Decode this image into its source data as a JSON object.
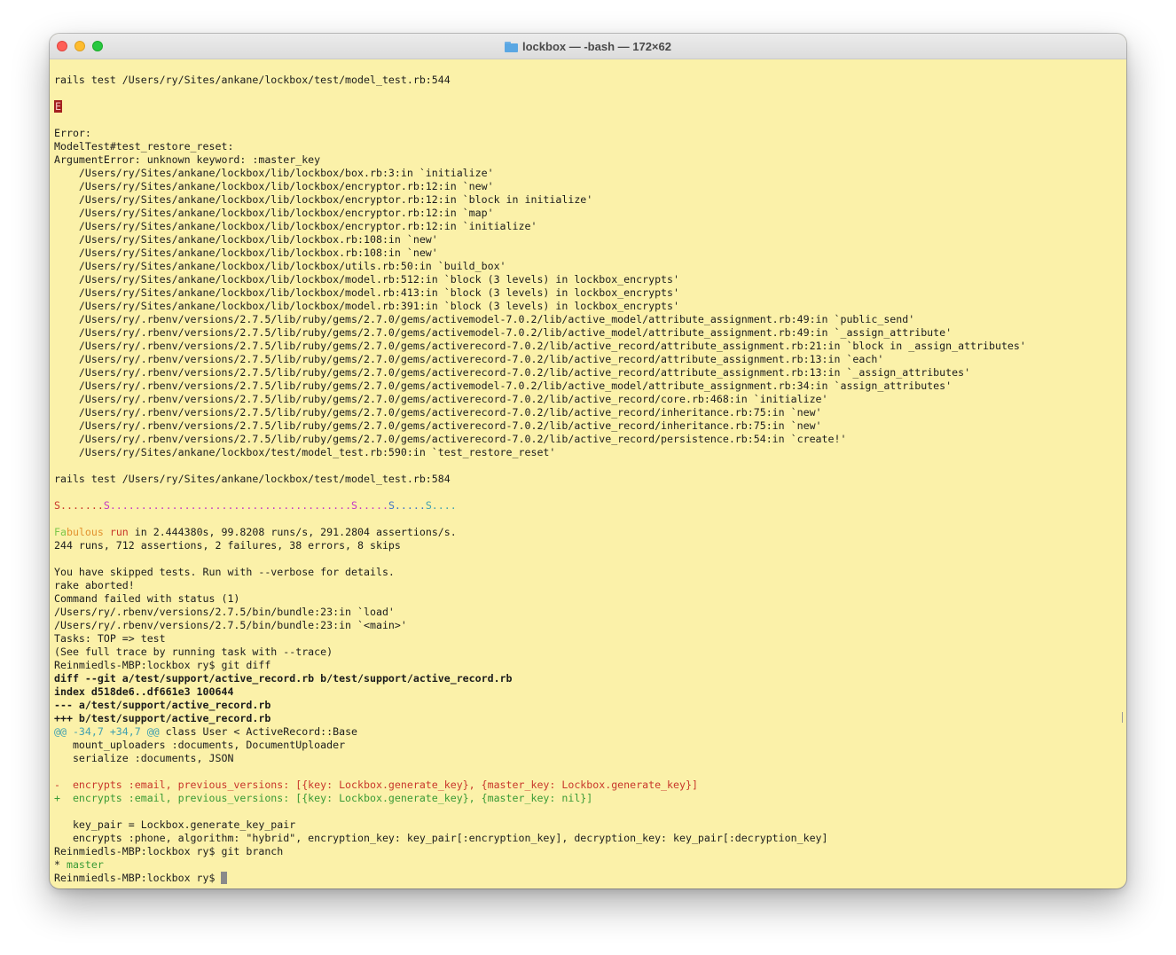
{
  "window": {
    "title": "lockbox — -bash — 172×62"
  },
  "colors": {
    "background": "#fbf1a9",
    "text": "#1c1c1c",
    "red": "#c8372b",
    "green": "#3a9a35",
    "magenta": "#c436c4",
    "blue": "#3f73c8",
    "cyan": "#40a0b0",
    "lightgreen": "#7dc74b",
    "orange": "#e2912e"
  },
  "terminal": {
    "lines": [
      [
        {
          "t": "rails test /Users/ry/Sites/ankane/lockbox/test/model_test.rb:544"
        }
      ],
      [],
      [
        {
          "t": "E",
          "c": "cursor-E"
        }
      ],
      [],
      [
        {
          "t": "Error:"
        }
      ],
      [
        {
          "t": "ModelTest#test_restore_reset:"
        }
      ],
      [
        {
          "t": "ArgumentError: unknown keyword: :master_key"
        }
      ],
      [
        {
          "t": "    /Users/ry/Sites/ankane/lockbox/lib/lockbox/box.rb:3:in `initialize'"
        }
      ],
      [
        {
          "t": "    /Users/ry/Sites/ankane/lockbox/lib/lockbox/encryptor.rb:12:in `new'"
        }
      ],
      [
        {
          "t": "    /Users/ry/Sites/ankane/lockbox/lib/lockbox/encryptor.rb:12:in `block in initialize'"
        }
      ],
      [
        {
          "t": "    /Users/ry/Sites/ankane/lockbox/lib/lockbox/encryptor.rb:12:in `map'"
        }
      ],
      [
        {
          "t": "    /Users/ry/Sites/ankane/lockbox/lib/lockbox/encryptor.rb:12:in `initialize'"
        }
      ],
      [
        {
          "t": "    /Users/ry/Sites/ankane/lockbox/lib/lockbox.rb:108:in `new'"
        }
      ],
      [
        {
          "t": "    /Users/ry/Sites/ankane/lockbox/lib/lockbox.rb:108:in `new'"
        }
      ],
      [
        {
          "t": "    /Users/ry/Sites/ankane/lockbox/lib/lockbox/utils.rb:50:in `build_box'"
        }
      ],
      [
        {
          "t": "    /Users/ry/Sites/ankane/lockbox/lib/lockbox/model.rb:512:in `block (3 levels) in lockbox_encrypts'"
        }
      ],
      [
        {
          "t": "    /Users/ry/Sites/ankane/lockbox/lib/lockbox/model.rb:413:in `block (3 levels) in lockbox_encrypts'"
        }
      ],
      [
        {
          "t": "    /Users/ry/Sites/ankane/lockbox/lib/lockbox/model.rb:391:in `block (3 levels) in lockbox_encrypts'"
        }
      ],
      [
        {
          "t": "    /Users/ry/.rbenv/versions/2.7.5/lib/ruby/gems/2.7.0/gems/activemodel-7.0.2/lib/active_model/attribute_assignment.rb:49:in `public_send'"
        }
      ],
      [
        {
          "t": "    /Users/ry/.rbenv/versions/2.7.5/lib/ruby/gems/2.7.0/gems/activemodel-7.0.2/lib/active_model/attribute_assignment.rb:49:in `_assign_attribute'"
        }
      ],
      [
        {
          "t": "    /Users/ry/.rbenv/versions/2.7.5/lib/ruby/gems/2.7.0/gems/activerecord-7.0.2/lib/active_record/attribute_assignment.rb:21:in `block in _assign_attributes'"
        }
      ],
      [
        {
          "t": "    /Users/ry/.rbenv/versions/2.7.5/lib/ruby/gems/2.7.0/gems/activerecord-7.0.2/lib/active_record/attribute_assignment.rb:13:in `each'"
        }
      ],
      [
        {
          "t": "    /Users/ry/.rbenv/versions/2.7.5/lib/ruby/gems/2.7.0/gems/activerecord-7.0.2/lib/active_record/attribute_assignment.rb:13:in `_assign_attributes'"
        }
      ],
      [
        {
          "t": "    /Users/ry/.rbenv/versions/2.7.5/lib/ruby/gems/2.7.0/gems/activemodel-7.0.2/lib/active_model/attribute_assignment.rb:34:in `assign_attributes'"
        }
      ],
      [
        {
          "t": "    /Users/ry/.rbenv/versions/2.7.5/lib/ruby/gems/2.7.0/gems/activerecord-7.0.2/lib/active_record/core.rb:468:in `initialize'"
        }
      ],
      [
        {
          "t": "    /Users/ry/.rbenv/versions/2.7.5/lib/ruby/gems/2.7.0/gems/activerecord-7.0.2/lib/active_record/inheritance.rb:75:in `new'"
        }
      ],
      [
        {
          "t": "    /Users/ry/.rbenv/versions/2.7.5/lib/ruby/gems/2.7.0/gems/activerecord-7.0.2/lib/active_record/inheritance.rb:75:in `new'"
        }
      ],
      [
        {
          "t": "    /Users/ry/.rbenv/versions/2.7.5/lib/ruby/gems/2.7.0/gems/activerecord-7.0.2/lib/active_record/persistence.rb:54:in `create!'"
        }
      ],
      [
        {
          "t": "    /Users/ry/Sites/ankane/lockbox/test/model_test.rb:590:in `test_restore_reset'"
        }
      ],
      [],
      [
        {
          "t": "rails test /Users/ry/Sites/ankane/lockbox/test/model_test.rb:584"
        }
      ],
      [],
      [
        {
          "t": "S.......",
          "k": "red"
        },
        {
          "t": "S.......................................",
          "k": "magenta"
        },
        {
          "t": "S.....",
          "k": "magenta"
        },
        {
          "t": "S.....",
          "k": "blue"
        },
        {
          "t": "S....",
          "k": "cyan"
        }
      ],
      [],
      [
        {
          "t": "Fa",
          "k": "lightgreen"
        },
        {
          "t": "bulous ",
          "k": "orange"
        },
        {
          "t": "run",
          "k": "red"
        },
        {
          "t": " in 2.444380s, 99.8208 runs/s, 291.2804 assertions/s."
        }
      ],
      [
        {
          "t": "244 runs, 712 assertions, 2 failures, 38 errors, 8 skips"
        }
      ],
      [],
      [
        {
          "t": "You have skipped tests. Run with --verbose for details."
        }
      ],
      [
        {
          "t": "rake aborted!"
        }
      ],
      [
        {
          "t": "Command failed with status (1)"
        }
      ],
      [
        {
          "t": "/Users/ry/.rbenv/versions/2.7.5/bin/bundle:23:in `load'"
        }
      ],
      [
        {
          "t": "/Users/ry/.rbenv/versions/2.7.5/bin/bundle:23:in `<main>'"
        }
      ],
      [
        {
          "t": "Tasks: TOP => test"
        }
      ],
      [
        {
          "t": "(See full trace by running task with --trace)"
        }
      ],
      [
        {
          "t": "Reinmiedls-MBP:lockbox ry$ git diff"
        }
      ],
      [
        {
          "t": "diff --git a/test/support/active_record.rb b/test/support/active_record.rb",
          "b": true
        }
      ],
      [
        {
          "t": "index d518de6..df661e3 100644",
          "b": true
        }
      ],
      [
        {
          "t": "--- a/test/support/active_record.rb",
          "b": true
        }
      ],
      [
        {
          "t": "+++ b/test/support/active_record.rb",
          "b": true
        }
      ],
      [
        {
          "t": "@@ -34,7 +34,7 @@",
          "k": "cyan"
        },
        {
          "t": " class User < ActiveRecord::Base"
        }
      ],
      [
        {
          "t": "   mount_uploaders :documents, DocumentUploader"
        }
      ],
      [
        {
          "t": "   serialize :documents, JSON"
        }
      ],
      [],
      [
        {
          "t": "-  encrypts :email, previous_versions: [{key: Lockbox.generate_key}, {master_key: Lockbox.generate_key}]",
          "k": "red"
        }
      ],
      [
        {
          "t": "+  encrypts :email, previous_versions: [{key: Lockbox.generate_key}, {master_key: nil}]",
          "k": "green"
        }
      ],
      [],
      [
        {
          "t": "   key_pair = Lockbox.generate_key_pair"
        }
      ],
      [
        {
          "t": "   encrypts :phone, algorithm: \"hybrid\", encryption_key: key_pair[:encryption_key], decryption_key: key_pair[:decryption_key]"
        }
      ],
      [
        {
          "t": "Reinmiedls-MBP:lockbox ry$ git branch"
        }
      ],
      [
        {
          "t": "* "
        },
        {
          "t": "master",
          "k": "green"
        }
      ],
      [
        {
          "t": "Reinmiedls-MBP:lockbox ry$ "
        }
      ]
    ]
  }
}
